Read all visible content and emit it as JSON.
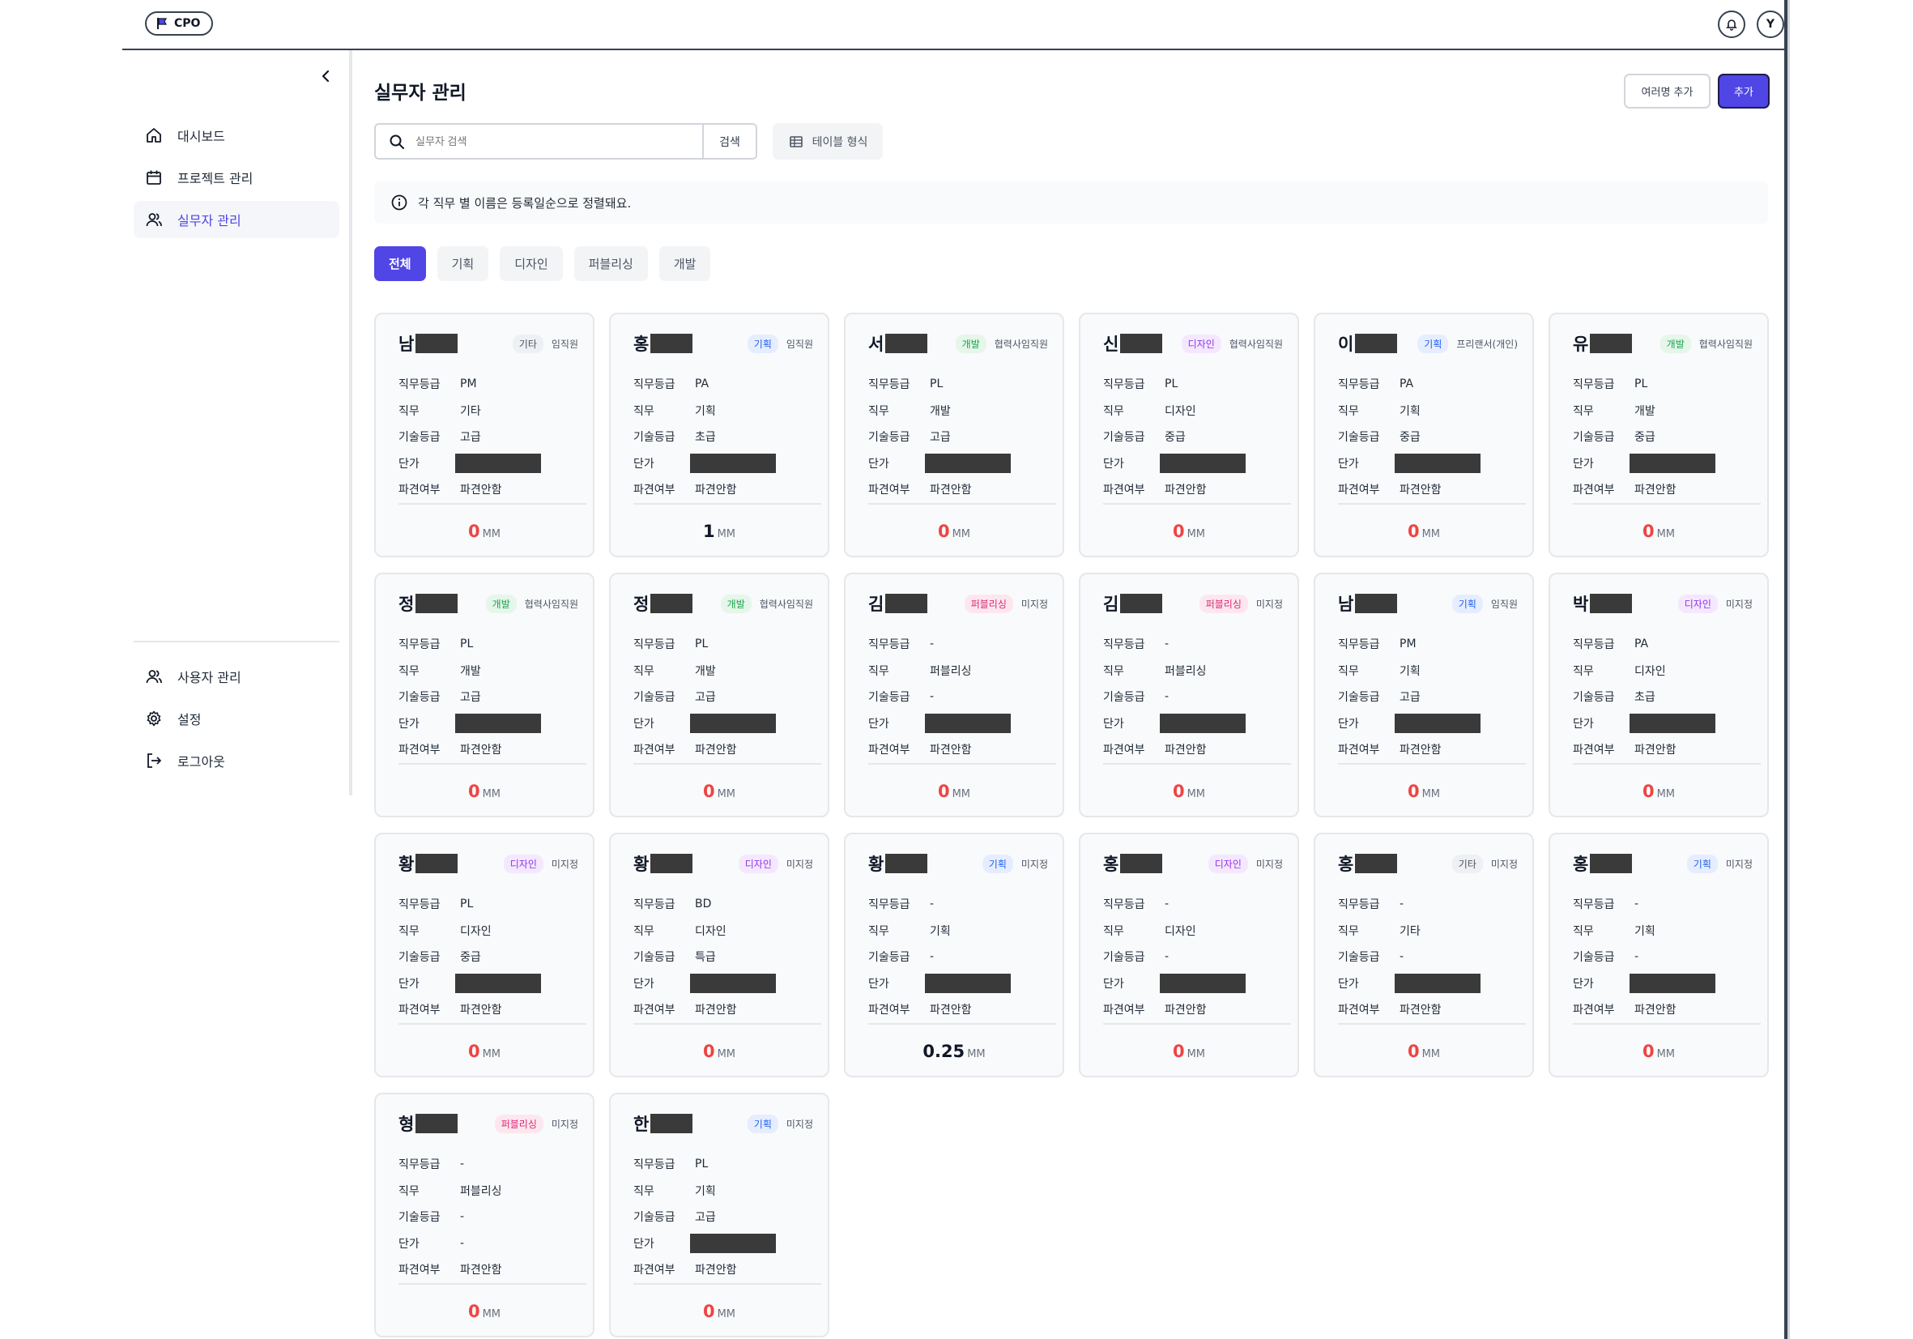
{
  "app": {
    "logo_text": "CPO",
    "user_initial": "Y"
  },
  "sidebar": {
    "items": [
      {
        "label": "대시보드",
        "icon": "home-icon",
        "active": false
      },
      {
        "label": "프로젝트 관리",
        "icon": "calendar-icon",
        "active": false
      },
      {
        "label": "실무자 관리",
        "icon": "users-icon",
        "active": true
      }
    ],
    "bottom_items": [
      {
        "label": "사용자 관리",
        "icon": "users-icon"
      },
      {
        "label": "설정",
        "icon": "gear-icon"
      },
      {
        "label": "로그아웃",
        "icon": "logout-icon"
      }
    ]
  },
  "main": {
    "title": "실무자 관리",
    "btn_multi": "여러명 추가",
    "btn_add": "추가",
    "search_placeholder": "실무자 검색",
    "search_button": "검색",
    "table_view": "테이블 형식",
    "notice": "각 직무 별 이름은 등록일순으로 정렬돼요.",
    "tabs": [
      "전체",
      "기획",
      "디자인",
      "퍼블리싱",
      "개발"
    ],
    "labels": {
      "grade": "직무등급",
      "job": "직무",
      "skill": "기술등급",
      "price": "단가",
      "dispatch": "파견여부",
      "unit": "MM"
    }
  },
  "colors": {
    "accent": "#4f46e5",
    "danger": "#ef4444"
  },
  "cards": [
    {
      "name": "남",
      "tag": "기타",
      "tag_color": "gray",
      "status": "임직원",
      "grade": "PM",
      "job": "기타",
      "skill": "고급",
      "price": "redacted",
      "dispatch": "파견안함",
      "mm": "0"
    },
    {
      "name": "홍",
      "tag": "기획",
      "tag_color": "blue",
      "status": "임직원",
      "grade": "PA",
      "job": "기획",
      "skill": "초급",
      "price": "redacted",
      "dispatch": "파견안함",
      "mm": "1"
    },
    {
      "name": "서",
      "tag": "개발",
      "tag_color": "green",
      "status": "협력사임직원",
      "grade": "PL",
      "job": "개발",
      "skill": "고급",
      "price": "redacted",
      "dispatch": "파견안함",
      "mm": "0"
    },
    {
      "name": "신",
      "tag": "디자인",
      "tag_color": "purple",
      "status": "협력사임직원",
      "grade": "PL",
      "job": "디자인",
      "skill": "중급",
      "price": "redacted",
      "dispatch": "파견안함",
      "mm": "0"
    },
    {
      "name": "이",
      "tag": "기획",
      "tag_color": "blue",
      "status": "프리랜서(개인)",
      "grade": "PA",
      "job": "기획",
      "skill": "중급",
      "price": "redacted",
      "dispatch": "파견안함",
      "mm": "0"
    },
    {
      "name": "유",
      "tag": "개발",
      "tag_color": "green",
      "status": "협력사임직원",
      "grade": "PL",
      "job": "개발",
      "skill": "중급",
      "price": "redacted",
      "dispatch": "파견안함",
      "mm": "0"
    },
    {
      "name": "정",
      "tag": "개발",
      "tag_color": "green",
      "status": "협력사임직원",
      "grade": "PL",
      "job": "개발",
      "skill": "고급",
      "price": "redacted",
      "dispatch": "파견안함",
      "mm": "0"
    },
    {
      "name": "정",
      "tag": "개발",
      "tag_color": "green",
      "status": "협력사임직원",
      "grade": "PL",
      "job": "개발",
      "skill": "고급",
      "price": "redacted",
      "dispatch": "파견안함",
      "mm": "0"
    },
    {
      "name": "김",
      "tag": "퍼블리싱",
      "tag_color": "pink",
      "status": "미지정",
      "grade": "-",
      "job": "퍼블리싱",
      "skill": "-",
      "price": "redacted",
      "dispatch": "파견안함",
      "mm": "0"
    },
    {
      "name": "김",
      "tag": "퍼블리싱",
      "tag_color": "pink",
      "status": "미지정",
      "grade": "-",
      "job": "퍼블리싱",
      "skill": "-",
      "price": "redacted",
      "dispatch": "파견안함",
      "mm": "0"
    },
    {
      "name": "남",
      "tag": "기획",
      "tag_color": "blue",
      "status": "임직원",
      "grade": "PM",
      "job": "기획",
      "skill": "고급",
      "price": "redacted",
      "dispatch": "파견안함",
      "mm": "0"
    },
    {
      "name": "박",
      "tag": "디자인",
      "tag_color": "purple",
      "status": "미지정",
      "grade": "PA",
      "job": "디자인",
      "skill": "초급",
      "price": "redacted",
      "dispatch": "파견안함",
      "mm": "0"
    },
    {
      "name": "황",
      "tag": "디자인",
      "tag_color": "purple",
      "status": "미지정",
      "grade": "PL",
      "job": "디자인",
      "skill": "중급",
      "price": "redacted",
      "dispatch": "파견안함",
      "mm": "0"
    },
    {
      "name": "황",
      "tag": "디자인",
      "tag_color": "purple",
      "status": "미지정",
      "grade": "BD",
      "job": "디자인",
      "skill": "특급",
      "price": "redacted",
      "dispatch": "파견안함",
      "mm": "0"
    },
    {
      "name": "황",
      "tag": "기획",
      "tag_color": "blue",
      "status": "미지정",
      "grade": "-",
      "job": "기획",
      "skill": "-",
      "price": "redacted",
      "dispatch": "파견안함",
      "mm": "0.25"
    },
    {
      "name": "홍",
      "tag": "디자인",
      "tag_color": "purple",
      "status": "미지정",
      "grade": "-",
      "job": "디자인",
      "skill": "-",
      "price": "redacted",
      "dispatch": "파견안함",
      "mm": "0"
    },
    {
      "name": "홍",
      "tag": "기타",
      "tag_color": "gray",
      "status": "미지정",
      "grade": "-",
      "job": "기타",
      "skill": "-",
      "price": "redacted",
      "dispatch": "파견안함",
      "mm": "0"
    },
    {
      "name": "홍",
      "tag": "기획",
      "tag_color": "blue",
      "status": "미지정",
      "grade": "-",
      "job": "기획",
      "skill": "-",
      "price": "redacted",
      "dispatch": "파견안함",
      "mm": "0"
    },
    {
      "name": "형",
      "tag": "퍼블리싱",
      "tag_color": "pink",
      "status": "미지정",
      "grade": "-",
      "job": "퍼블리싱",
      "skill": "-",
      "price": "-",
      "dispatch": "파견안함",
      "mm": "0"
    },
    {
      "name": "한",
      "tag": "기획",
      "tag_color": "blue",
      "status": "미지정",
      "grade": "PL",
      "job": "기획",
      "skill": "고급",
      "price": "redacted",
      "dispatch": "파견안함",
      "mm": "0"
    }
  ]
}
